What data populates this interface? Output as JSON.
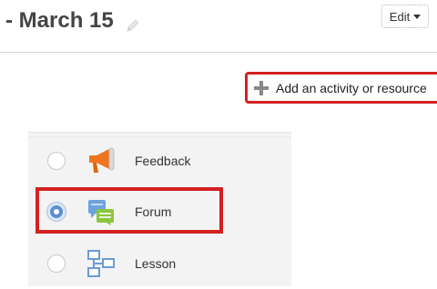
{
  "section": {
    "title": "- March 15"
  },
  "edit_menu": {
    "label": "Edit"
  },
  "add_activity": {
    "label": "Add an activity or resource"
  },
  "activity_chooser": {
    "items": [
      {
        "label": "Feedback",
        "icon": "megaphone-icon",
        "selected": false
      },
      {
        "label": "Forum",
        "icon": "forum-speech-bubbles-icon",
        "selected": true
      },
      {
        "label": "Lesson",
        "icon": "lesson-flowchart-icon",
        "selected": false
      }
    ]
  },
  "colors": {
    "highlight_red": "#d32020",
    "selected_radio": "#5a8fd1",
    "feedback_orange": "#f0731e",
    "forum_green": "#8cc63e",
    "forum_blue": "#6ea3dd",
    "lesson_blue": "#6b9ad8"
  }
}
